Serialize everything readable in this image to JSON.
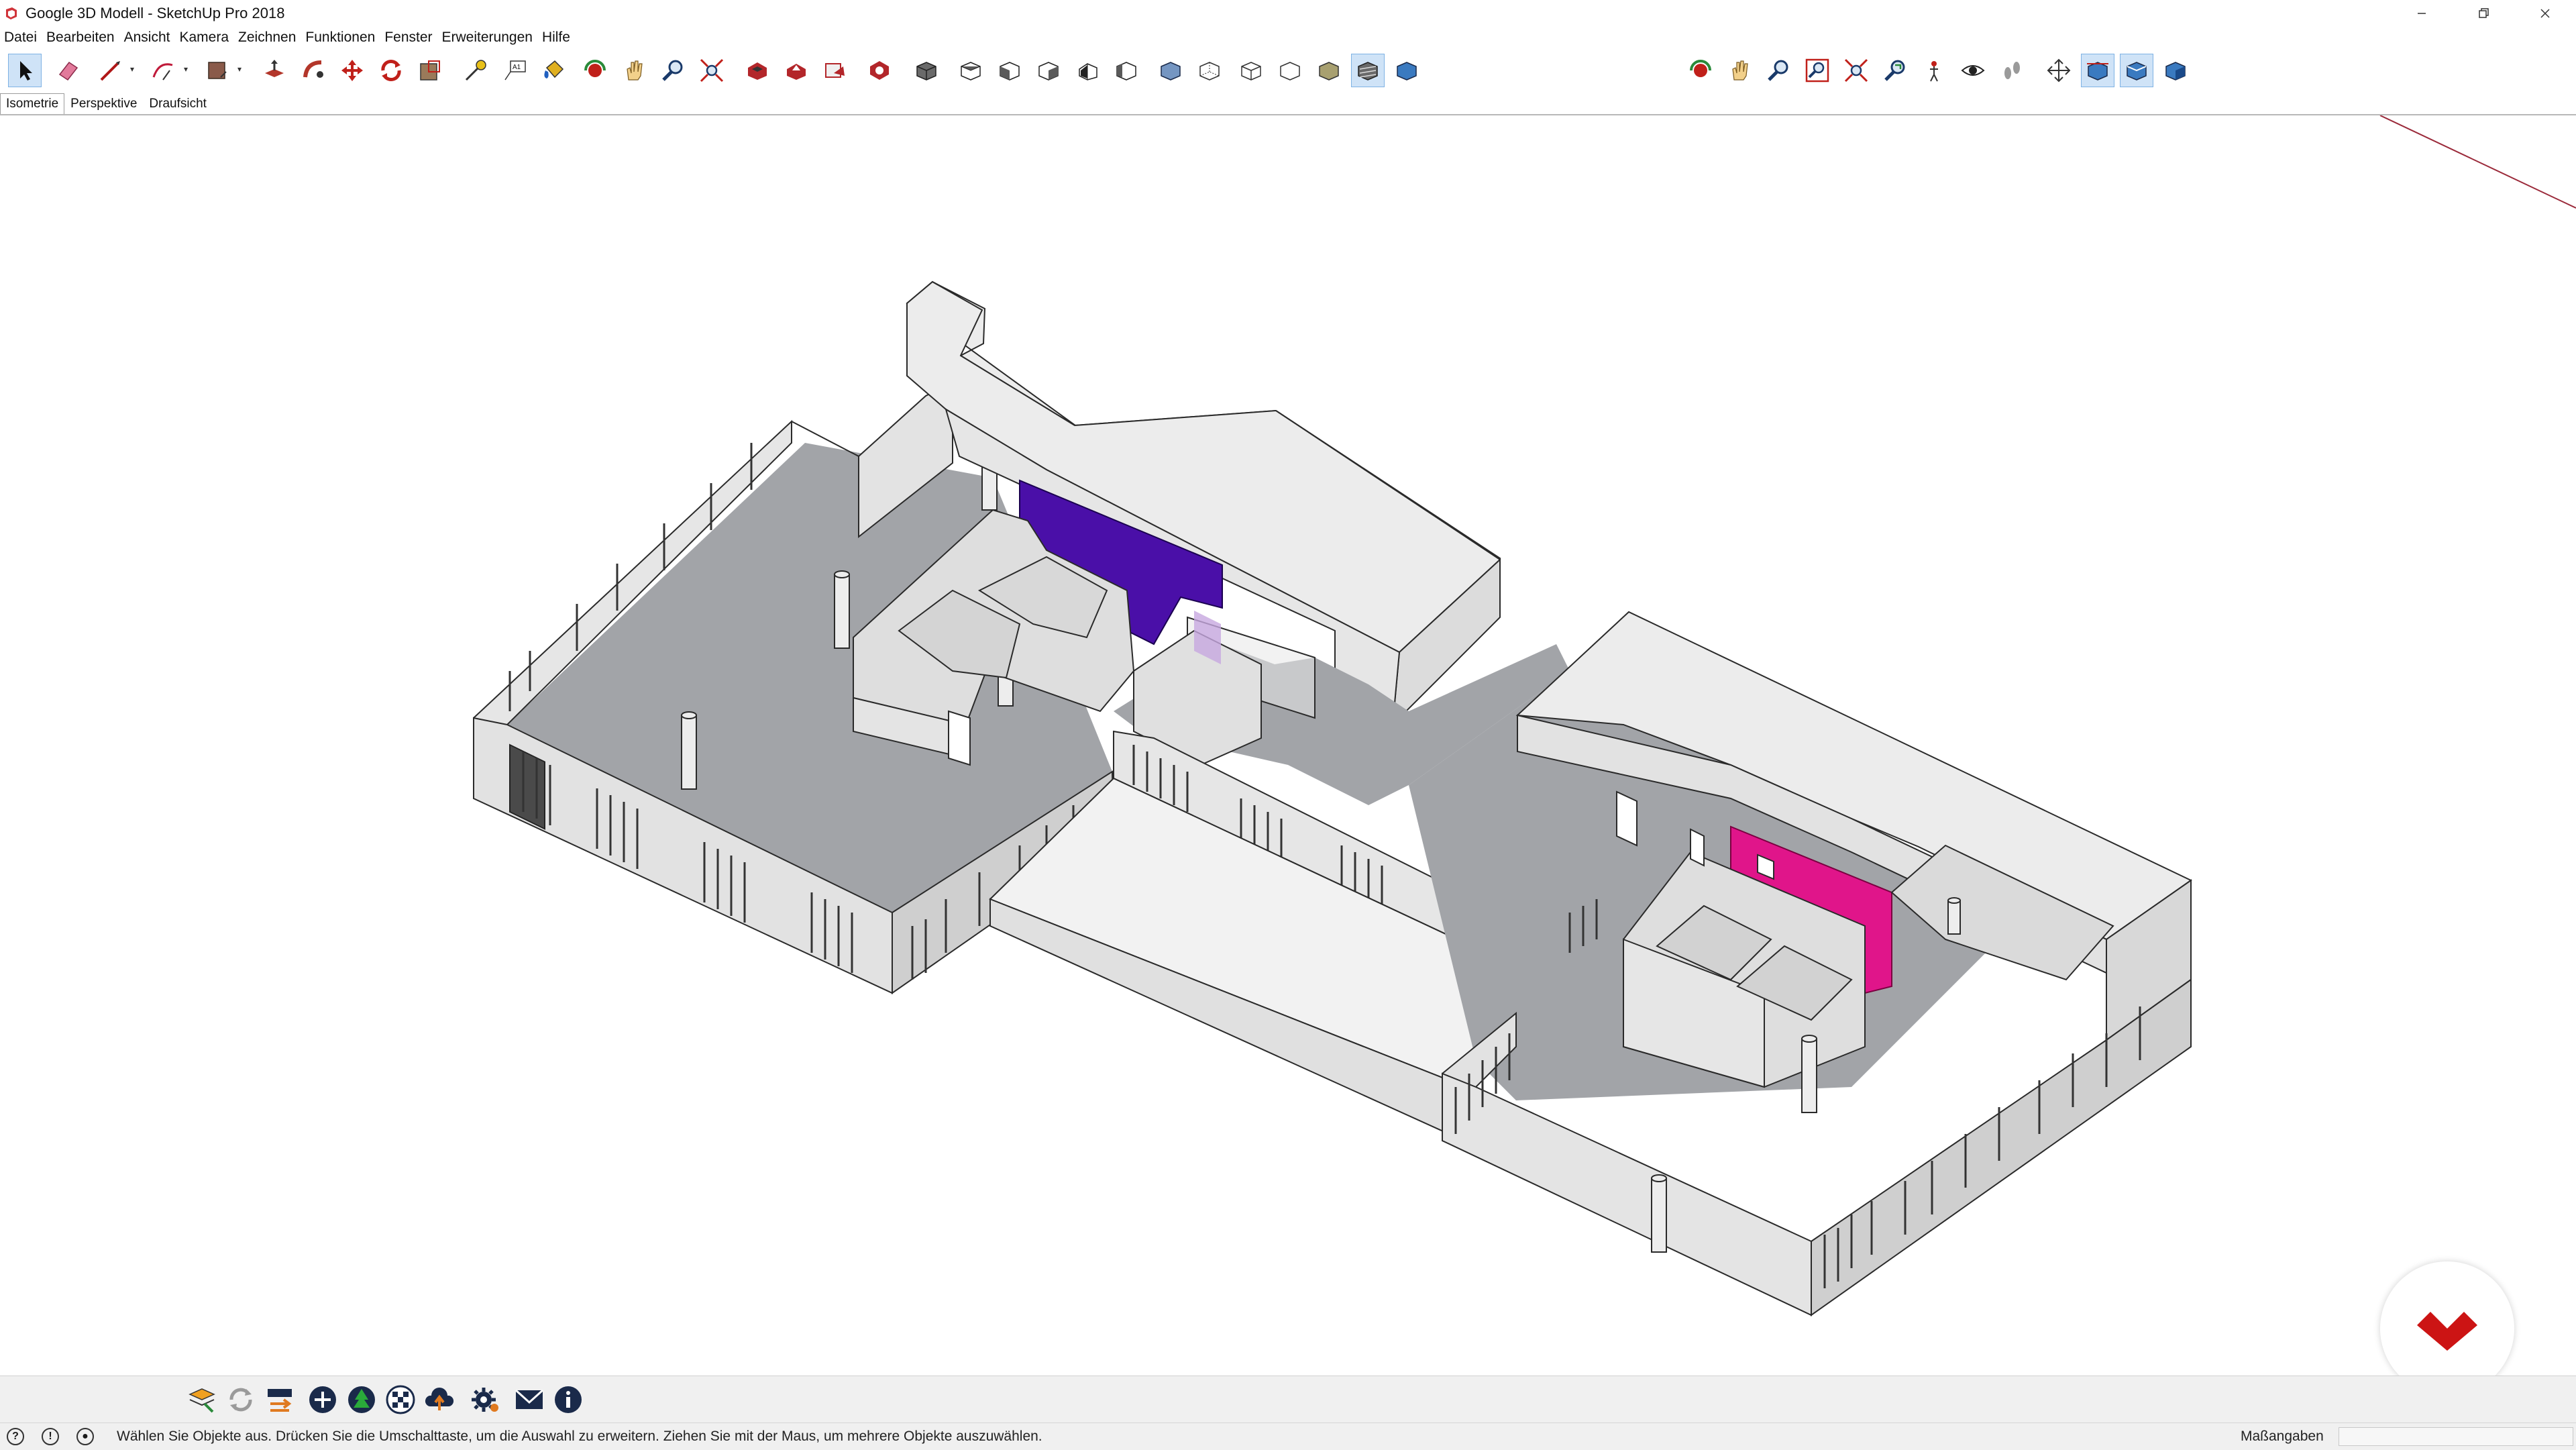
{
  "window": {
    "title": "Google 3D Modell - SketchUp Pro 2018",
    "controls": [
      "minimize",
      "restore",
      "close"
    ]
  },
  "menu": {
    "items": [
      "Datei",
      "Bearbeiten",
      "Ansicht",
      "Kamera",
      "Zeichnen",
      "Funktionen",
      "Fenster",
      "Erweiterungen",
      "Hilfe"
    ]
  },
  "toolbar": {
    "tools": [
      {
        "name": "select-tool-icon",
        "active": true
      },
      {
        "name": "eraser-tool-icon"
      },
      {
        "name": "line-tool-icon",
        "dropdown": true
      },
      {
        "name": "arc-tool-icon",
        "dropdown": true
      },
      {
        "name": "shape-tool-icon",
        "dropdown": true
      },
      {
        "name": "push-pull-tool-icon"
      },
      {
        "name": "follow-me-tool-icon"
      },
      {
        "name": "move-tool-icon"
      },
      {
        "name": "rotate-tool-icon"
      },
      {
        "name": "scale-tool-icon"
      },
      {
        "name": "tape-measure-tool-icon"
      },
      {
        "name": "text-tool-icon"
      },
      {
        "name": "paint-bucket-tool-icon"
      },
      {
        "name": "orbit-tool-icon"
      },
      {
        "name": "pan-tool-icon"
      },
      {
        "name": "zoom-tool-icon"
      },
      {
        "name": "zoom-extents-icon"
      },
      {
        "name": "warehouse-icon"
      },
      {
        "name": "share-model-icon"
      },
      {
        "name": "layout-send-icon"
      },
      {
        "name": "extension-warehouse-icon"
      },
      {
        "name": "iso-view-icon"
      },
      {
        "name": "top-view-icon"
      },
      {
        "name": "front-view-icon"
      },
      {
        "name": "right-view-icon"
      },
      {
        "name": "back-view-icon"
      },
      {
        "name": "left-view-icon"
      },
      {
        "name": "xray-style-icon"
      },
      {
        "name": "back-edges-style-icon"
      },
      {
        "name": "wireframe-style-icon"
      },
      {
        "name": "hidden-line-style-icon"
      },
      {
        "name": "shaded-style-icon"
      },
      {
        "name": "shaded-textures-style-icon",
        "active": true
      },
      {
        "name": "monochrome-style-icon"
      },
      {
        "name": "orbit-view-icon"
      },
      {
        "name": "pan-view-icon"
      },
      {
        "name": "zoom-view-icon"
      },
      {
        "name": "zoom-window-icon"
      },
      {
        "name": "zoom-extents-view-icon"
      },
      {
        "name": "previous-view-icon"
      },
      {
        "name": "position-camera-icon"
      },
      {
        "name": "look-around-icon"
      },
      {
        "name": "walk-icon"
      },
      {
        "name": "section-plane-icon"
      },
      {
        "name": "display-section-planes-icon",
        "active": true
      },
      {
        "name": "display-section-cuts-icon",
        "active": true
      },
      {
        "name": "display-section-fill-icon"
      }
    ]
  },
  "scenes": {
    "tabs": [
      {
        "label": "Isometrie",
        "active": true
      },
      {
        "label": "Perspektive",
        "active": false
      },
      {
        "label": "Draufsicht",
        "active": false
      }
    ]
  },
  "viewport": {
    "colors": {
      "floor": "#a2a4a8",
      "wall": "#e3e3e3",
      "wall_shadow": "#cfcfcf",
      "roof": "#ebebeb",
      "outline": "#2a2a2a",
      "highlight_purple": "#4a0fa8",
      "highlight_magenta": "#e0158a",
      "axis_red": "#9b2a3a"
    }
  },
  "extensions": {
    "icons": [
      "layers-edit-icon",
      "refresh-icon",
      "transfer-icon",
      "add-circle-icon",
      "tree-icon",
      "checker-icon",
      "cloud-upload-icon",
      "settings-gear-icon",
      "mail-icon",
      "info-icon"
    ]
  },
  "status": {
    "message": "Wählen Sie Objekte aus. Drücken Sie die Umschalttaste, um die Auswahl zu erweitern. Ziehen Sie mit der Maus, um mehrere Objekte auszuwählen.",
    "measurements_label": "Maßangaben",
    "measurements_value": ""
  }
}
